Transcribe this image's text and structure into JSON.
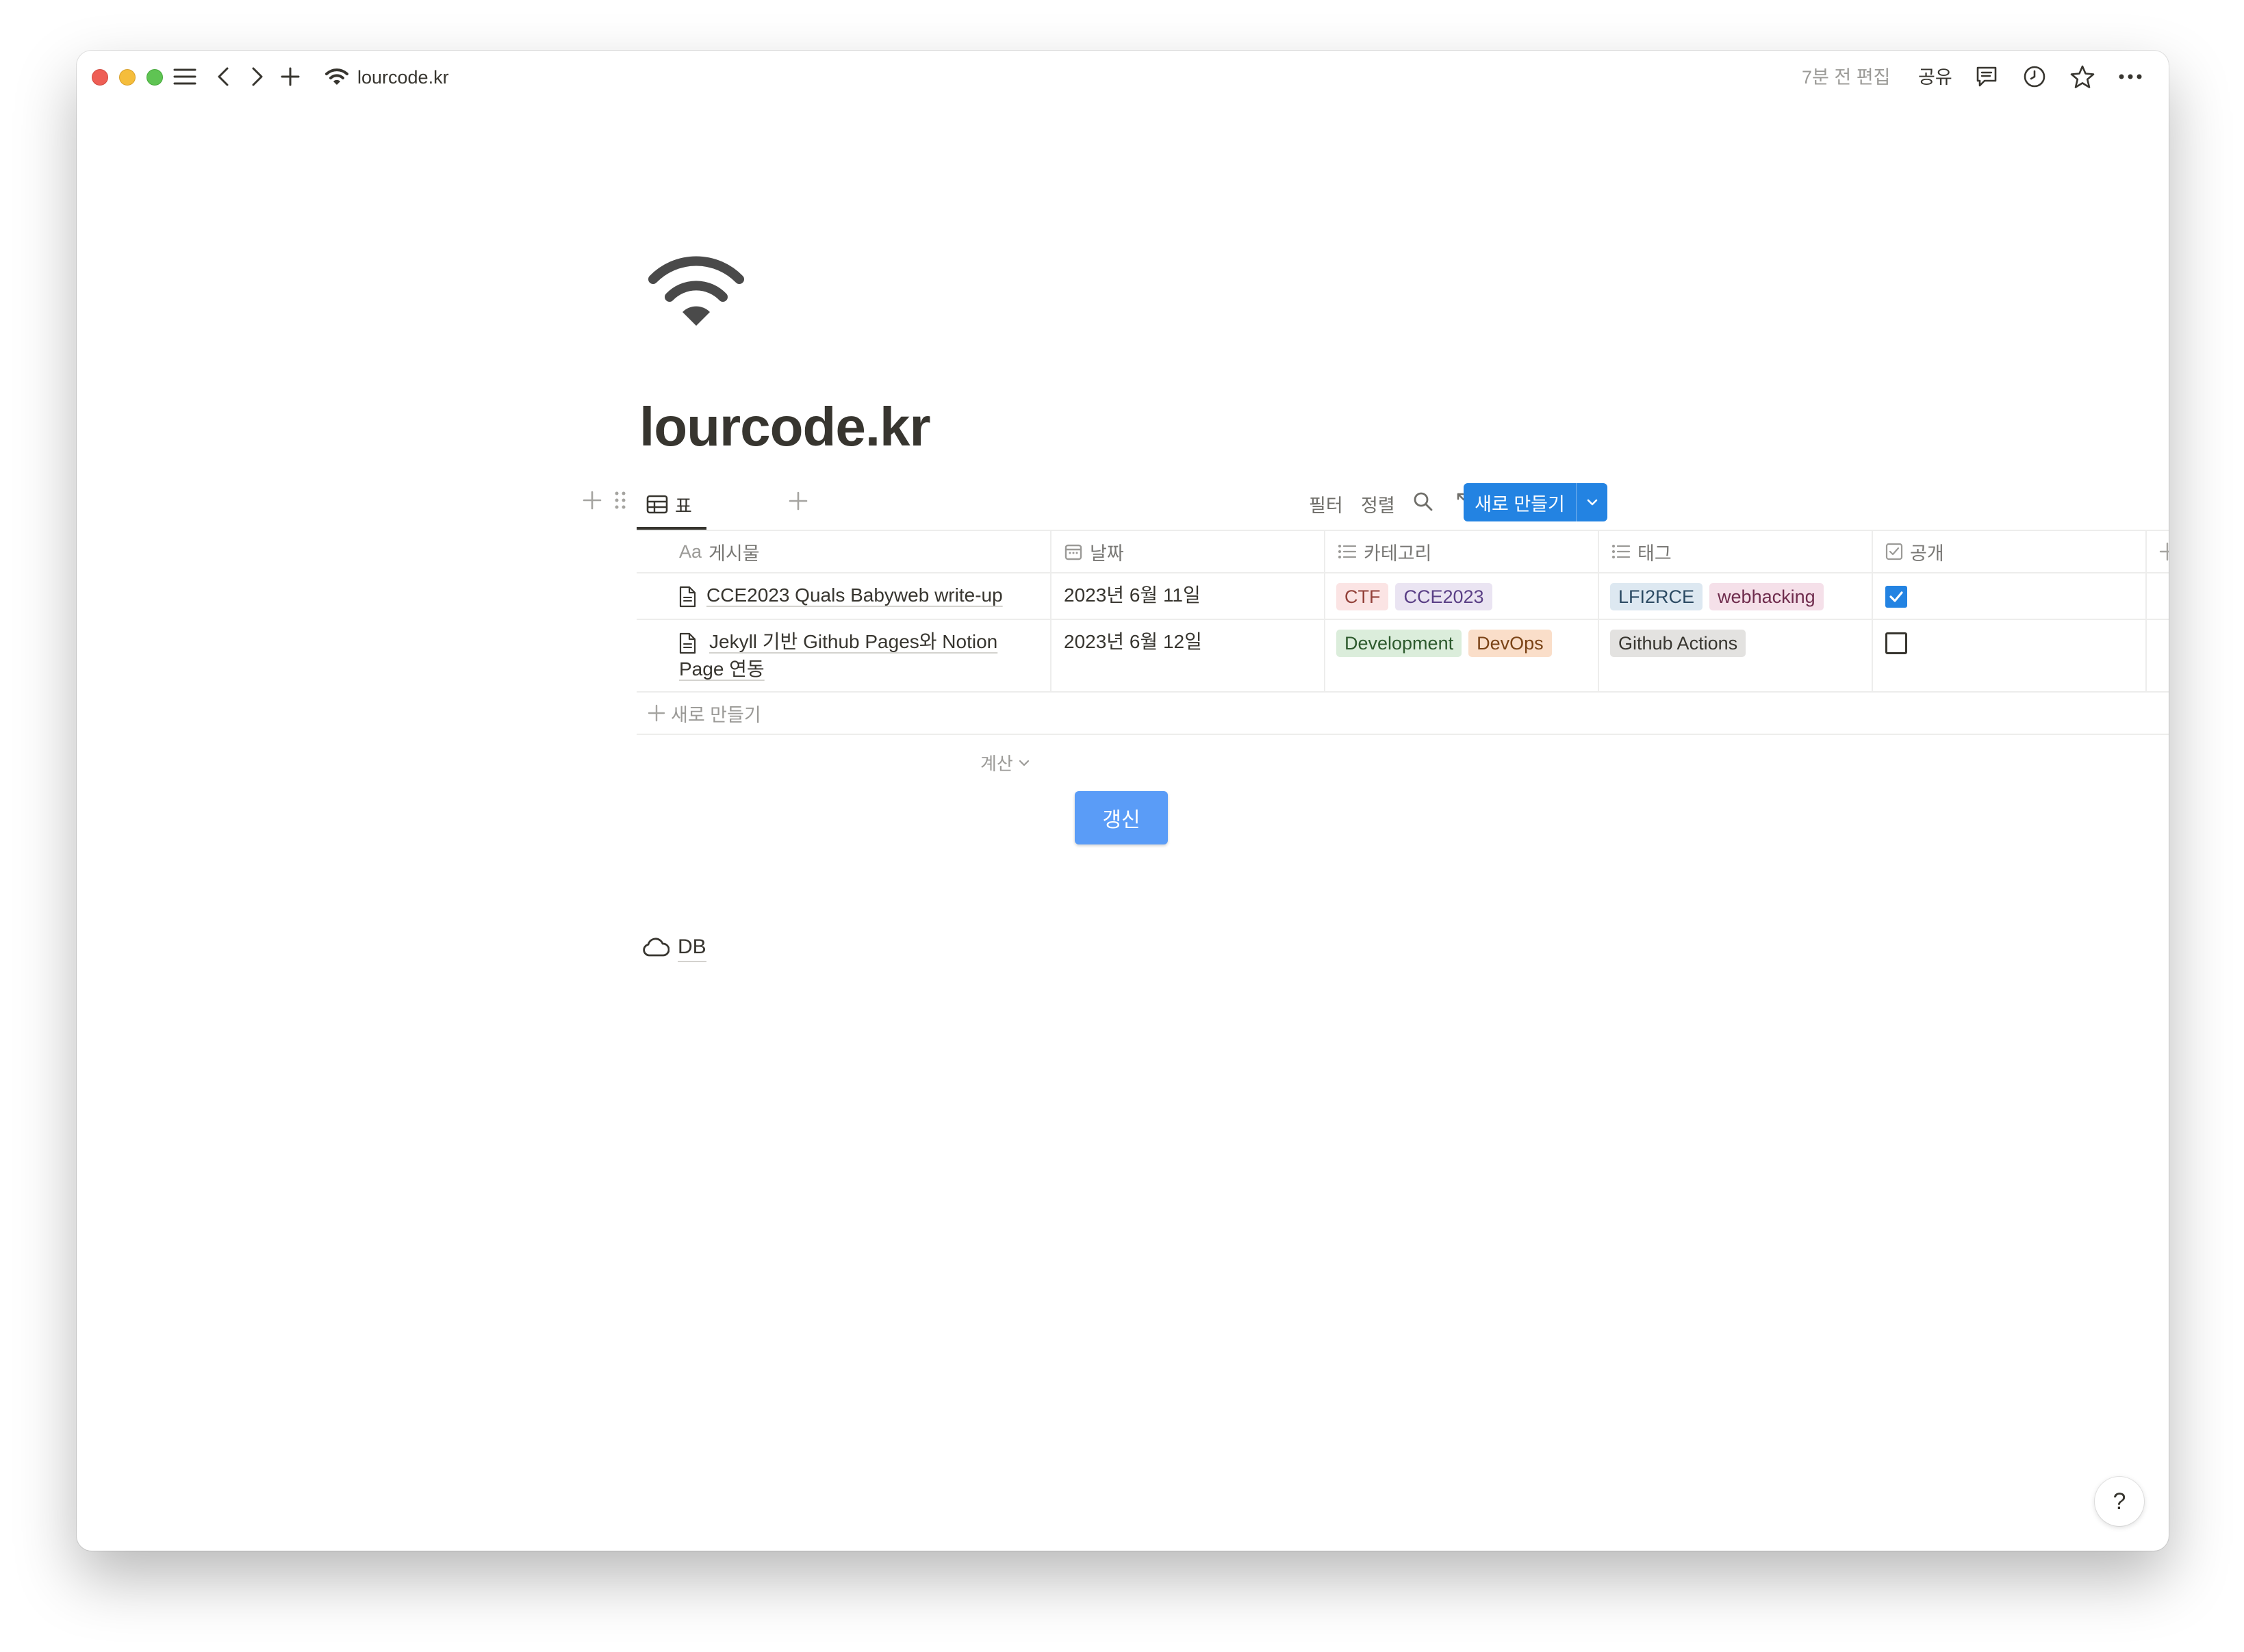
{
  "titlebar": {
    "address": "lourcode.kr",
    "edited": "7분 전 편집",
    "share": "공유"
  },
  "page": {
    "title": "lourcode.kr",
    "icon": "wifi-icon"
  },
  "view": {
    "tab_label": "표",
    "filter": "필터",
    "sort": "정렬",
    "new_button": "새로 만들기"
  },
  "table": {
    "columns": [
      {
        "icon": "Aa",
        "label": "게시물"
      },
      {
        "icon": "calendar-icon",
        "label": "날짜"
      },
      {
        "icon": "list-icon",
        "label": "카테고리"
      },
      {
        "icon": "list-icon",
        "label": "태그"
      },
      {
        "icon": "checkbox-icon",
        "label": "공개"
      }
    ],
    "rows": [
      {
        "title": "CCE2023 Quals Babyweb write-up",
        "date": "2023년 6월 11일",
        "categories": [
          {
            "label": "CTF",
            "bg": "#fbe4e4",
            "fg": "#93413a"
          },
          {
            "label": "CCE2023",
            "bg": "#eae4f2",
            "fg": "#5a3f86"
          }
        ],
        "tags": [
          {
            "label": "LFI2RCE",
            "bg": "#dde8f1",
            "fg": "#2b4a63"
          },
          {
            "label": "webhacking",
            "bg": "#f5e0e9",
            "fg": "#6f2c4d"
          }
        ],
        "public": true
      },
      {
        "title": "Jekyll 기반 Github Pages와 Notion Page 연동",
        "date": "2023년 6월 12일",
        "categories": [
          {
            "label": "Development",
            "bg": "#dbeddb",
            "fg": "#2d5a2d"
          },
          {
            "label": "DevOps",
            "bg": "#fadec9",
            "fg": "#7a4316"
          }
        ],
        "tags": [
          {
            "label": "Github Actions",
            "bg": "#e3e2e0",
            "fg": "#37352f"
          }
        ],
        "public": false
      }
    ],
    "new_row": "새로 만들기",
    "calculate": "계산"
  },
  "refresh_button": "갱신",
  "db_link": "DB",
  "help": "?",
  "colors": {
    "accent": "#2383e2",
    "refresh": "#5a9cf7"
  }
}
